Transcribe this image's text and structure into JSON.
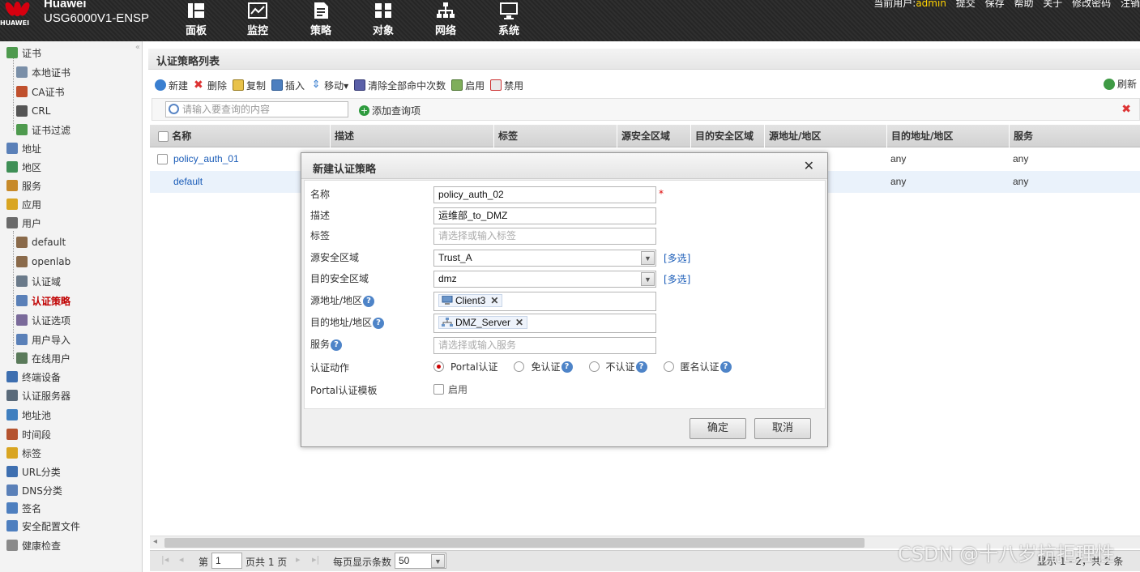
{
  "header": {
    "brand_logo_text": "HUAWEI",
    "product_name": "Huawei",
    "product_model": "USG6000V1-ENSP",
    "nav": [
      {
        "label": "面板",
        "icon": "dashboard-icon"
      },
      {
        "label": "监控",
        "icon": "monitor-icon"
      },
      {
        "label": "策略",
        "icon": "policy-icon"
      },
      {
        "label": "对象",
        "icon": "object-icon"
      },
      {
        "label": "网络",
        "icon": "network-icon"
      },
      {
        "label": "系统",
        "icon": "system-icon"
      }
    ],
    "current_user_label": "当前用户:",
    "current_user": "admin",
    "links": [
      "提交",
      "保存",
      "帮助",
      "关于",
      "修改密码",
      "注销"
    ]
  },
  "sidebar": {
    "items": [
      {
        "label": "证书",
        "icon": "certificate-icon"
      },
      {
        "label": "本地证书",
        "icon": "local-certificate-icon"
      },
      {
        "label": "CA证书",
        "icon": "ca-certificate-icon"
      },
      {
        "label": "CRL",
        "icon": "crl-icon"
      },
      {
        "label": "证书过滤",
        "icon": "certificate-filter-icon"
      },
      {
        "label": "地址",
        "icon": "address-icon"
      },
      {
        "label": "地区",
        "icon": "region-icon"
      },
      {
        "label": "服务",
        "icon": "service-icon"
      },
      {
        "label": "应用",
        "icon": "application-icon"
      },
      {
        "label": "用户",
        "icon": "user-icon"
      },
      {
        "label": "default",
        "icon": "user-group-icon"
      },
      {
        "label": "openlab",
        "icon": "user-group-icon"
      },
      {
        "label": "认证域",
        "icon": "auth-domain-icon"
      },
      {
        "label": "认证策略",
        "icon": "auth-policy-icon"
      },
      {
        "label": "认证选项",
        "icon": "auth-option-icon"
      },
      {
        "label": "用户导入",
        "icon": "user-import-icon"
      },
      {
        "label": "在线用户",
        "icon": "online-user-icon"
      },
      {
        "label": "终端设备",
        "icon": "terminal-device-icon"
      },
      {
        "label": "认证服务器",
        "icon": "auth-server-icon"
      },
      {
        "label": "地址池",
        "icon": "address-pool-icon"
      },
      {
        "label": "时间段",
        "icon": "time-range-icon"
      },
      {
        "label": "标签",
        "icon": "tag-icon"
      },
      {
        "label": "URL分类",
        "icon": "url-category-icon"
      },
      {
        "label": "DNS分类",
        "icon": "dns-category-icon"
      },
      {
        "label": "签名",
        "icon": "signature-icon"
      },
      {
        "label": "安全配置文件",
        "icon": "security-profile-icon"
      },
      {
        "label": "健康检查",
        "icon": "health-check-icon"
      }
    ]
  },
  "main": {
    "title": "认证策略列表",
    "toolbar": [
      {
        "label": "新建",
        "icon": "add-icon"
      },
      {
        "label": "删除",
        "icon": "delete-icon"
      },
      {
        "label": "复制",
        "icon": "copy-icon"
      },
      {
        "label": "插入",
        "icon": "insert-icon"
      },
      {
        "label": "移动▾",
        "icon": "move-icon"
      },
      {
        "label": "清除全部命中次数",
        "icon": "clear-hits-icon"
      },
      {
        "label": "启用",
        "icon": "enable-icon"
      },
      {
        "label": "禁用",
        "icon": "disable-icon"
      }
    ],
    "refresh_label": "刷新",
    "search_placeholder": "请输入要查询的内容",
    "add_query_label": "添加查询项",
    "columns": [
      "名称",
      "描述",
      "标签",
      "源安全区域",
      "目的安全区域",
      "源地址/地区",
      "目的地址/地区",
      "服务"
    ],
    "rows": [
      {
        "name": "policy_auth_01",
        "dst_addr": "any",
        "service": "any"
      },
      {
        "name": "default",
        "dst_addr": "any",
        "service": "any"
      }
    ],
    "pager": {
      "page_prefix": "第",
      "page_value": "1",
      "page_suffix": "页共 1 页",
      "per_page_label": "每页显示条数",
      "per_page_value": "50",
      "summary": "显示 1 - 2，共 2 条"
    }
  },
  "dialog": {
    "title": "新建认证策略",
    "fields": {
      "name_label": "名称",
      "name_value": "policy_auth_02",
      "desc_label": "描述",
      "desc_value": "运维部_to_DMZ",
      "tag_label": "标签",
      "tag_placeholder": "请选择或输入标签",
      "src_zone_label": "源安全区域",
      "src_zone_value": "Trust_A",
      "dst_zone_label": "目的安全区域",
      "dst_zone_value": "dmz",
      "multi_select": "[多选]",
      "src_addr_label": "源地址/地区",
      "src_addr_tag": "Client3",
      "dst_addr_label": "目的地址/地区",
      "dst_addr_tag": "DMZ_Server",
      "service_label": "服务",
      "service_placeholder": "请选择或输入服务",
      "action_label": "认证动作",
      "actions": [
        "Portal认证",
        "免认证",
        "不认证",
        "匿名认证"
      ],
      "selected_action": "Portal认证",
      "portal_template_label": "Portal认证模板",
      "enable_label": "启用"
    },
    "ok_label": "确定",
    "cancel_label": "取消"
  },
  "watermark": "CSDN @十八岁抗拒理性",
  "colors": {
    "accent_red": "#c00000",
    "link_blue": "#1a5cb8",
    "header_bg": "#2b2b2b",
    "brand_red": "#d7000f"
  }
}
